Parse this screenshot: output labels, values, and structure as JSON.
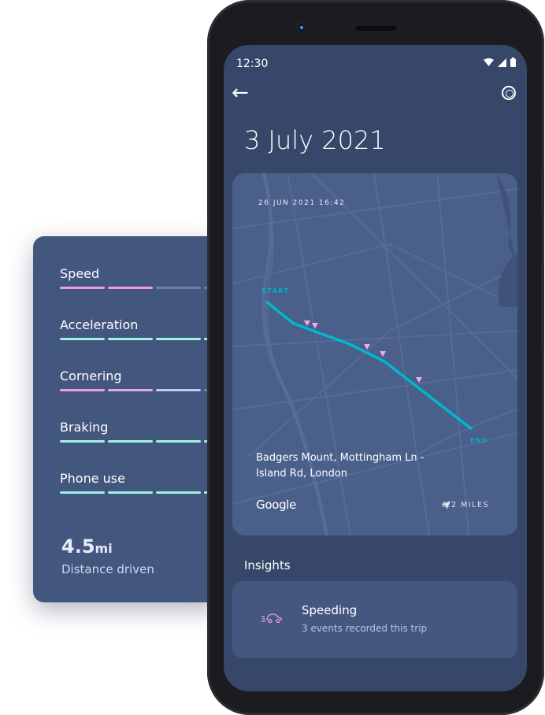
{
  "summary_card": {
    "metrics": [
      {
        "label": "Speed",
        "segments": [
          "#f29be0",
          "#f29be0",
          "#6f7f9e",
          "#6f7f9e"
        ]
      },
      {
        "label": "Acceleration",
        "segments": [
          "#9ff3e6",
          "#9ff3e6",
          "#9ff3e6",
          "#9ff3e6"
        ]
      },
      {
        "label": "Cornering",
        "segments": [
          "#f29be0",
          "#e0a8ea",
          "#c8c6f2",
          "#6f7f9e"
        ]
      },
      {
        "label": "Braking",
        "segments": [
          "#9ff3e6",
          "#9ff3e6",
          "#9ff3e6",
          "#9ff3e6"
        ]
      },
      {
        "label": "Phone use",
        "segments": [
          "#9ff3e6",
          "#9ff3e6",
          "#9ff3e6",
          "#9ff3e6"
        ]
      }
    ],
    "distance_value": "4.5",
    "distance_unit": "mi",
    "distance_label": "Distance driven"
  },
  "status_bar": {
    "time": "12:30"
  },
  "header": {
    "title": "3 July 2021",
    "back_icon": "arrow-left-icon",
    "action_icon": "steering-wheel-icon"
  },
  "map_card": {
    "timestamp": "26 JUN 2021 16:42",
    "start_label": "START",
    "end_label": "END",
    "address": "Badgers Mount, Mottingham Ln - Island Rd, London",
    "attribution": "Google",
    "distance": "6.2 MILES",
    "route_color": "#00b8cc",
    "event_color": "#f7a8e6"
  },
  "insights": {
    "heading": "Insights",
    "items": [
      {
        "title": "Speeding",
        "subtitle": "3 events recorded this trip",
        "icon": "speeding-car-icon"
      }
    ]
  }
}
